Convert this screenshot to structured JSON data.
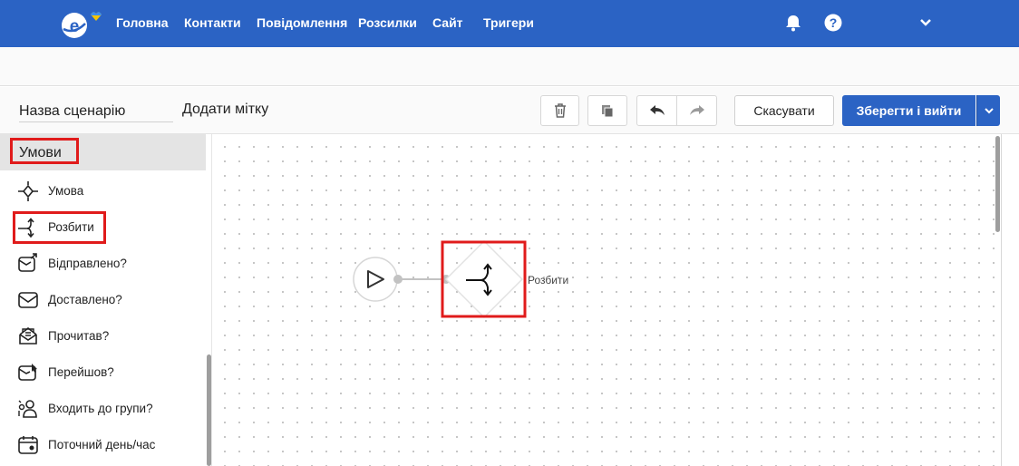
{
  "nav": {
    "items": [
      "Головна",
      "Контакти",
      "Повідомлення",
      "Розсилки",
      "Сайт",
      "Тригери"
    ],
    "accent": "#2b63c4"
  },
  "toolbar": {
    "scenario_name_placeholder": "Назва сценарію",
    "add_tag_label": "Додати мітку",
    "cancel_label": "Скасувати",
    "save_label": "Зберегти і вийти",
    "icons": [
      "trash-icon",
      "copy-icon",
      "undo-icon",
      "redo-icon",
      "chevron-down-icon"
    ]
  },
  "sidebar": {
    "section_title": "Умови",
    "items": [
      {
        "label": "Умова",
        "icon": "condition-icon"
      },
      {
        "label": "Розбити",
        "icon": "split-icon"
      },
      {
        "label": "Відправлено?",
        "icon": "sent-mail-icon"
      },
      {
        "label": "Доставлено?",
        "icon": "delivered-mail-icon"
      },
      {
        "label": "Прочитав?",
        "icon": "read-mail-icon"
      },
      {
        "label": "Перейшов?",
        "icon": "clicked-mail-icon"
      },
      {
        "label": "Входить до групи?",
        "icon": "group-icon"
      },
      {
        "label": "Поточний день/час",
        "icon": "calendar-clock-icon"
      }
    ]
  },
  "canvas": {
    "split_node_label": "Розбити",
    "highlight_color": "#e01b1b"
  }
}
